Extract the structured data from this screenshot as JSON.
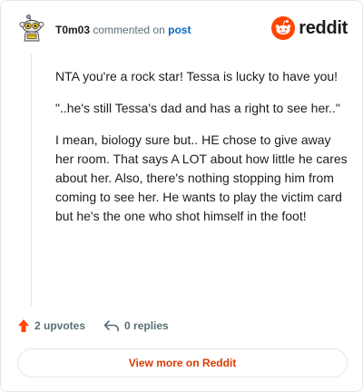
{
  "header": {
    "username": "T0m03",
    "action": "commented on",
    "post_link": "post",
    "brand": "reddit"
  },
  "comment": {
    "paragraphs": [
      "NTA you're a rock star! Tessa is lucky to have you!",
      "\"..he's still Tessa's dad and has a right to see her..\"",
      "I mean, biology sure but.. HE chose to give away her room. That says A LOT about how little he cares about her. Also, there's nothing stopping him from coming to see her. He wants to play the victim card but he's the one who shot himself in the foot!"
    ]
  },
  "footer": {
    "upvotes": "2 upvotes",
    "replies": "0 replies"
  },
  "view_more": "View more on Reddit",
  "colors": {
    "accent": "#ff4500",
    "link": "#0a66c2",
    "view_more": "#d93a00"
  }
}
